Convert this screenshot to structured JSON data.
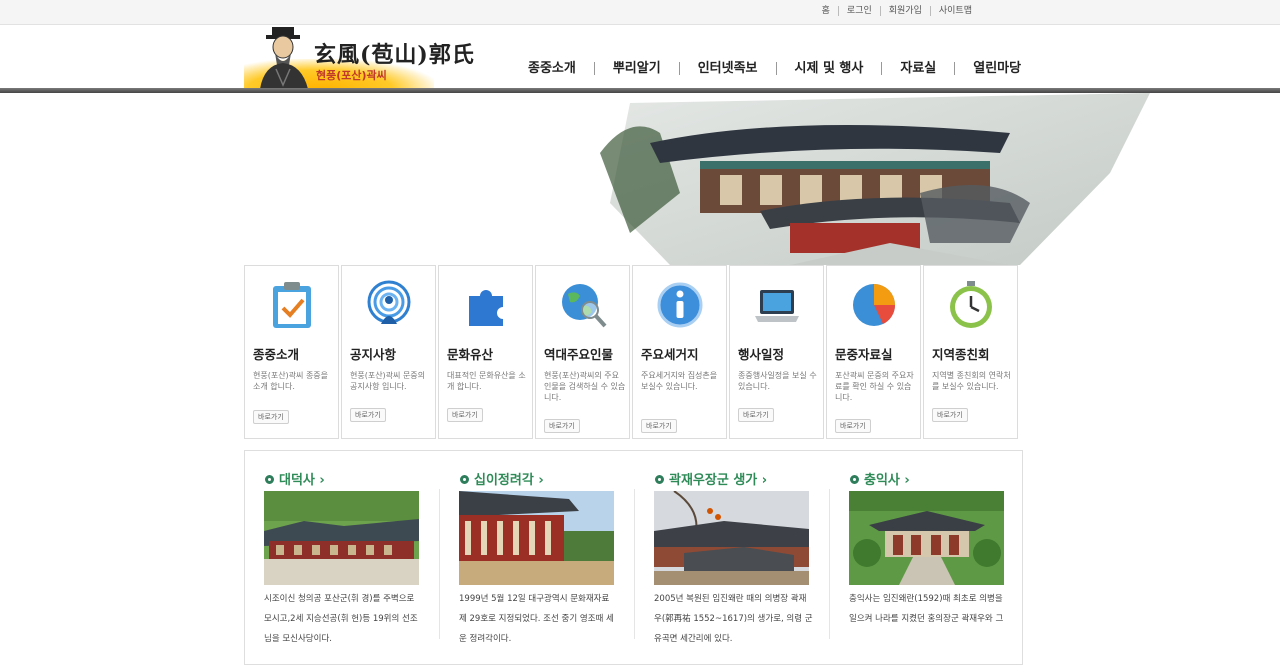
{
  "util_nav": [
    "홈",
    "로그인",
    "회원가입",
    "사이트맵"
  ],
  "logo": {
    "hanja": "玄風(苞山)郭氏",
    "korean": "현풍(포산)곽씨"
  },
  "gnb": [
    "종중소개",
    "뿌리알기",
    "인터넷족보",
    "시제 및 행사",
    "자료실",
    "열린마당"
  ],
  "quick_boxes": [
    {
      "title": "종중소개",
      "desc": "현풍(포산)곽씨 종중을 소개 합니다.",
      "button": "바로가기",
      "icon": "clipboard-check-icon"
    },
    {
      "title": "공지사항",
      "desc": "현풍(포산)곽씨 문중의 공지사항 입니다.",
      "button": "바로가기",
      "icon": "broadcast-icon"
    },
    {
      "title": "문화유산",
      "desc": "대표적인 문화유산을 소개 합니다.",
      "button": "바로가기",
      "icon": "puzzle-icon"
    },
    {
      "title": "역대주요인물",
      "desc": "현풍(포산)곽씨의 주요인물을 검색하실 수 있습니다.",
      "button": "바로가기",
      "icon": "globe-search-icon"
    },
    {
      "title": "주요세거지",
      "desc": "주요세거지와 집성촌을 보실수 있습니다.",
      "button": "바로가기",
      "icon": "info-icon"
    },
    {
      "title": "행사일정",
      "desc": "종중행사일정을 보실 수 있습니다.",
      "button": "바로가기",
      "icon": "laptop-icon"
    },
    {
      "title": "문중자료실",
      "desc": "포산곽씨 문중의 주요자료를 확인 하실 수 있습니다.",
      "button": "바로가기",
      "icon": "pie-chart-icon"
    },
    {
      "title": "지역종친회",
      "desc": "지역별 종친회의 연락처를 보실수 있습니다.",
      "button": "바로가기",
      "icon": "clock-icon"
    }
  ],
  "features": [
    {
      "title": "대덕사",
      "desc": "시조이신 청의공 포산군(휘 경)를 주벽으로 모시고,2세 지승선공(휘 헌)등 19위의 선조님을 모신사당이다."
    },
    {
      "title": "십이정려각",
      "desc": "1999년 5월 12일 대구광역시 문화재자료 제 29호로 지정되었다. 조선 중기 영조때 세운 정려각이다."
    },
    {
      "title": "곽재우장군 생가",
      "desc": "2005년 복원된 임진왜란 때의 의병장 곽재우(郭再祐 1552~1617)의 생가로, 의령 군 유곡면 세간리에 있다."
    },
    {
      "title": "충익사",
      "desc": "충익사는 임진왜란(1592)때 최초로 의병을 일으켜 나라를 지켰던 홍의장군 곽재우와 그"
    }
  ],
  "colors": {
    "accent": "#2e8b57",
    "header_bar": "#555555",
    "logo_sun": "#ffb300"
  }
}
